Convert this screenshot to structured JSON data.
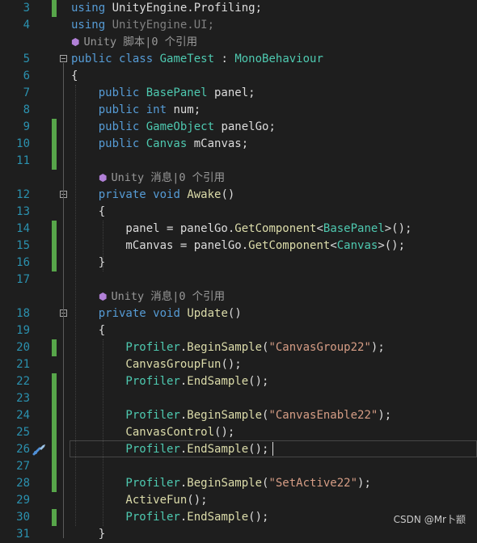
{
  "editor": {
    "lines": [
      {
        "num": "3",
        "changed": true,
        "segs": [
          {
            "t": "using ",
            "c": "kw"
          },
          {
            "t": "UnityEngine.Profiling;",
            "c": "tx"
          }
        ]
      },
      {
        "num": "4",
        "changed": false,
        "segs": [
          {
            "t": "using ",
            "c": "kw"
          },
          {
            "t": "UnityEngine.UI;",
            "c": "gr"
          }
        ]
      },
      {
        "lens": "Unity 脚本|0 个引用"
      },
      {
        "num": "5",
        "changed": false,
        "fold": true,
        "segs": [
          {
            "t": "public ",
            "c": "kw"
          },
          {
            "t": "class ",
            "c": "kw"
          },
          {
            "t": "GameTest",
            "c": "ty"
          },
          {
            "t": " : ",
            "c": "tx"
          },
          {
            "t": "MonoBehaviour",
            "c": "ty"
          }
        ]
      },
      {
        "num": "6",
        "changed": false,
        "segs": [
          {
            "t": "{",
            "c": "tx"
          }
        ]
      },
      {
        "num": "7",
        "changed": false,
        "segs": [
          {
            "t": "    public ",
            "c": "kw"
          },
          {
            "t": "BasePanel",
            "c": "ty"
          },
          {
            "t": " panel;",
            "c": "tx"
          }
        ]
      },
      {
        "num": "8",
        "changed": false,
        "segs": [
          {
            "t": "    public ",
            "c": "kw"
          },
          {
            "t": "int",
            "c": "kw"
          },
          {
            "t": " num;",
            "c": "tx"
          }
        ]
      },
      {
        "num": "9",
        "changed": true,
        "segs": [
          {
            "t": "    public ",
            "c": "kw"
          },
          {
            "t": "GameObject",
            "c": "ty"
          },
          {
            "t": " panelGo;",
            "c": "tx"
          }
        ]
      },
      {
        "num": "10",
        "changed": true,
        "segs": [
          {
            "t": "    public ",
            "c": "kw"
          },
          {
            "t": "Canvas",
            "c": "ty"
          },
          {
            "t": " mCanvas;",
            "c": "tx"
          }
        ]
      },
      {
        "num": "11",
        "changed": true,
        "segs": []
      },
      {
        "lens": "Unity 消息|0 个引用",
        "indent": 1
      },
      {
        "num": "12",
        "changed": false,
        "fold": true,
        "segs": [
          {
            "t": "    private ",
            "c": "kw"
          },
          {
            "t": "void ",
            "c": "kw"
          },
          {
            "t": "Awake",
            "c": "me"
          },
          {
            "t": "()",
            "c": "tx"
          }
        ]
      },
      {
        "num": "13",
        "changed": false,
        "segs": [
          {
            "t": "    {",
            "c": "tx"
          }
        ]
      },
      {
        "num": "14",
        "changed": true,
        "segs": [
          {
            "t": "        panel = panelGo.",
            "c": "tx"
          },
          {
            "t": "GetComponent",
            "c": "me"
          },
          {
            "t": "<",
            "c": "tx"
          },
          {
            "t": "BasePanel",
            "c": "ty"
          },
          {
            "t": ">();",
            "c": "tx"
          }
        ]
      },
      {
        "num": "15",
        "changed": true,
        "segs": [
          {
            "t": "        mCanvas = panelGo.",
            "c": "tx"
          },
          {
            "t": "GetComponent",
            "c": "me"
          },
          {
            "t": "<",
            "c": "tx"
          },
          {
            "t": "Canvas",
            "c": "ty"
          },
          {
            "t": ">();",
            "c": "tx"
          }
        ]
      },
      {
        "num": "16",
        "changed": true,
        "segs": [
          {
            "t": "    }",
            "c": "tx"
          }
        ]
      },
      {
        "num": "17",
        "changed": false,
        "segs": []
      },
      {
        "lens": "Unity 消息|0 个引用",
        "indent": 1
      },
      {
        "num": "18",
        "changed": false,
        "fold": true,
        "segs": [
          {
            "t": "    private ",
            "c": "kw"
          },
          {
            "t": "void ",
            "c": "kw"
          },
          {
            "t": "Update",
            "c": "me"
          },
          {
            "t": "()",
            "c": "tx"
          }
        ]
      },
      {
        "num": "19",
        "changed": false,
        "segs": [
          {
            "t": "    {",
            "c": "tx"
          }
        ]
      },
      {
        "num": "20",
        "changed": true,
        "segs": [
          {
            "t": "        Profiler",
            "c": "ty"
          },
          {
            "t": ".",
            "c": "tx"
          },
          {
            "t": "BeginSample",
            "c": "me"
          },
          {
            "t": "(",
            "c": "tx"
          },
          {
            "t": "\"CanvasGroup22\"",
            "c": "st"
          },
          {
            "t": ");",
            "c": "tx"
          }
        ]
      },
      {
        "num": "21",
        "changed": false,
        "segs": [
          {
            "t": "        CanvasGroupFun",
            "c": "me"
          },
          {
            "t": "();",
            "c": "tx"
          }
        ]
      },
      {
        "num": "22",
        "changed": true,
        "segs": [
          {
            "t": "        Profiler",
            "c": "ty"
          },
          {
            "t": ".",
            "c": "tx"
          },
          {
            "t": "EndSample",
            "c": "me"
          },
          {
            "t": "();",
            "c": "tx"
          }
        ]
      },
      {
        "num": "23",
        "changed": true,
        "segs": []
      },
      {
        "num": "24",
        "changed": true,
        "segs": [
          {
            "t": "        Profiler",
            "c": "ty"
          },
          {
            "t": ".",
            "c": "tx"
          },
          {
            "t": "BeginSample",
            "c": "me"
          },
          {
            "t": "(",
            "c": "tx"
          },
          {
            "t": "\"CanvasEnable22\"",
            "c": "st"
          },
          {
            "t": ");",
            "c": "tx"
          }
        ]
      },
      {
        "num": "25",
        "changed": true,
        "segs": [
          {
            "t": "        CanvasControl",
            "c": "me"
          },
          {
            "t": "();",
            "c": "tx"
          }
        ]
      },
      {
        "num": "26",
        "changed": true,
        "segs": [
          {
            "t": "        Profiler",
            "c": "ty"
          },
          {
            "t": ".",
            "c": "tx"
          },
          {
            "t": "EndSample",
            "c": "me"
          },
          {
            "t": "();",
            "c": "tx"
          }
        ]
      },
      {
        "num": "27",
        "changed": true,
        "segs": []
      },
      {
        "num": "28",
        "changed": true,
        "segs": [
          {
            "t": "        Profiler",
            "c": "ty"
          },
          {
            "t": ".",
            "c": "tx"
          },
          {
            "t": "BeginSample",
            "c": "me"
          },
          {
            "t": "(",
            "c": "tx"
          },
          {
            "t": "\"SetActive22\"",
            "c": "st"
          },
          {
            "t": ");",
            "c": "tx"
          }
        ]
      },
      {
        "num": "29",
        "changed": false,
        "segs": [
          {
            "t": "        ActiveFun",
            "c": "me"
          },
          {
            "t": "();",
            "c": "tx"
          }
        ]
      },
      {
        "num": "30",
        "changed": true,
        "segs": [
          {
            "t": "        Profiler",
            "c": "ty"
          },
          {
            "t": ".",
            "c": "tx"
          },
          {
            "t": "EndSample",
            "c": "me"
          },
          {
            "t": "();",
            "c": "tx"
          }
        ]
      },
      {
        "num": "31",
        "changed": false,
        "segs": [
          {
            "t": "    }",
            "c": "tx"
          }
        ]
      }
    ]
  },
  "watermark": "CSDN @Mr卜颛",
  "colors": {
    "keyword": "#569cd6",
    "type": "#4ec9b0",
    "method": "#dcdcaa",
    "string": "#d69d85",
    "line_number": "#2b91af",
    "change_bar": "#57a64a"
  }
}
